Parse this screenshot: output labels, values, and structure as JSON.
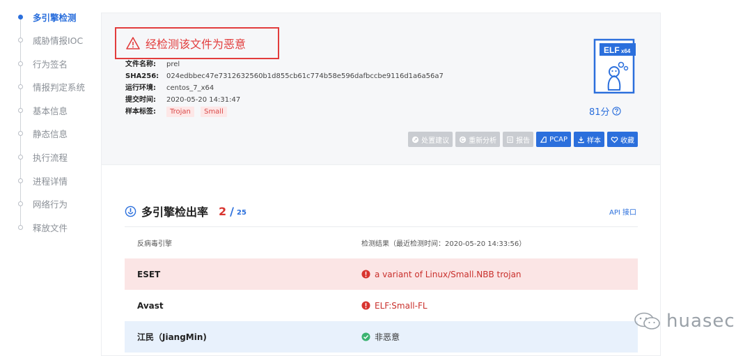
{
  "nav": {
    "items": [
      {
        "label": "多引擎检测",
        "active": true
      },
      {
        "label": "威胁情报IOC",
        "active": false
      },
      {
        "label": "行为签名",
        "active": false
      },
      {
        "label": "情报判定系统",
        "active": false
      },
      {
        "label": "基本信息",
        "active": false
      },
      {
        "label": "静态信息",
        "active": false
      },
      {
        "label": "执行流程",
        "active": false
      },
      {
        "label": "进程详情",
        "active": false
      },
      {
        "label": "网络行为",
        "active": false
      },
      {
        "label": "释放文件",
        "active": false
      }
    ]
  },
  "summary": {
    "verdict": "经检测该文件为恶意",
    "meta": {
      "file_name_label": "文件名称:",
      "file_name": "prel",
      "sha256_label": "SHA256:",
      "sha256": "024edbbec47e7312632560b1d855cb61c774b58e596dafbccbe9116d1a6a56a7",
      "env_label": "运行环境:",
      "env": "centos_7_x64",
      "submit_label": "提交时间:",
      "submit_time": "2020-05-20 14:31:47",
      "tags_label": "样本标签:",
      "tags": [
        "Trojan",
        "Small"
      ]
    },
    "file_type_badge": "ELF",
    "file_type_sub": "x64",
    "score": "81分"
  },
  "actions": {
    "advice": "处置建议",
    "reanalyze": "重新分析",
    "report": "报告",
    "pcap": "PCAP",
    "sample": "样本",
    "favorite": "收藏"
  },
  "detection": {
    "title": "多引擎检出率",
    "detected": "2",
    "slash": "/",
    "total": "25",
    "api_link": "API 接口",
    "header_engine": "反病毒引擎",
    "header_result": "检测结果（最近检测时间：2020-05-20 14:33:56）",
    "rows": [
      {
        "engine": "ESET",
        "result": "a variant of Linux/Small.NBB trojan",
        "status": "malicious"
      },
      {
        "engine": "Avast",
        "result": "ELF:Small-FL",
        "status": "malicious"
      },
      {
        "engine": "江民（JiangMin)",
        "result": "非恶意",
        "status": "clean"
      }
    ]
  },
  "watermark": {
    "text": "huasec"
  },
  "colors": {
    "accent": "#2b6fdc",
    "danger": "#e23c3c",
    "summary_bg": "#f6f7f9"
  }
}
